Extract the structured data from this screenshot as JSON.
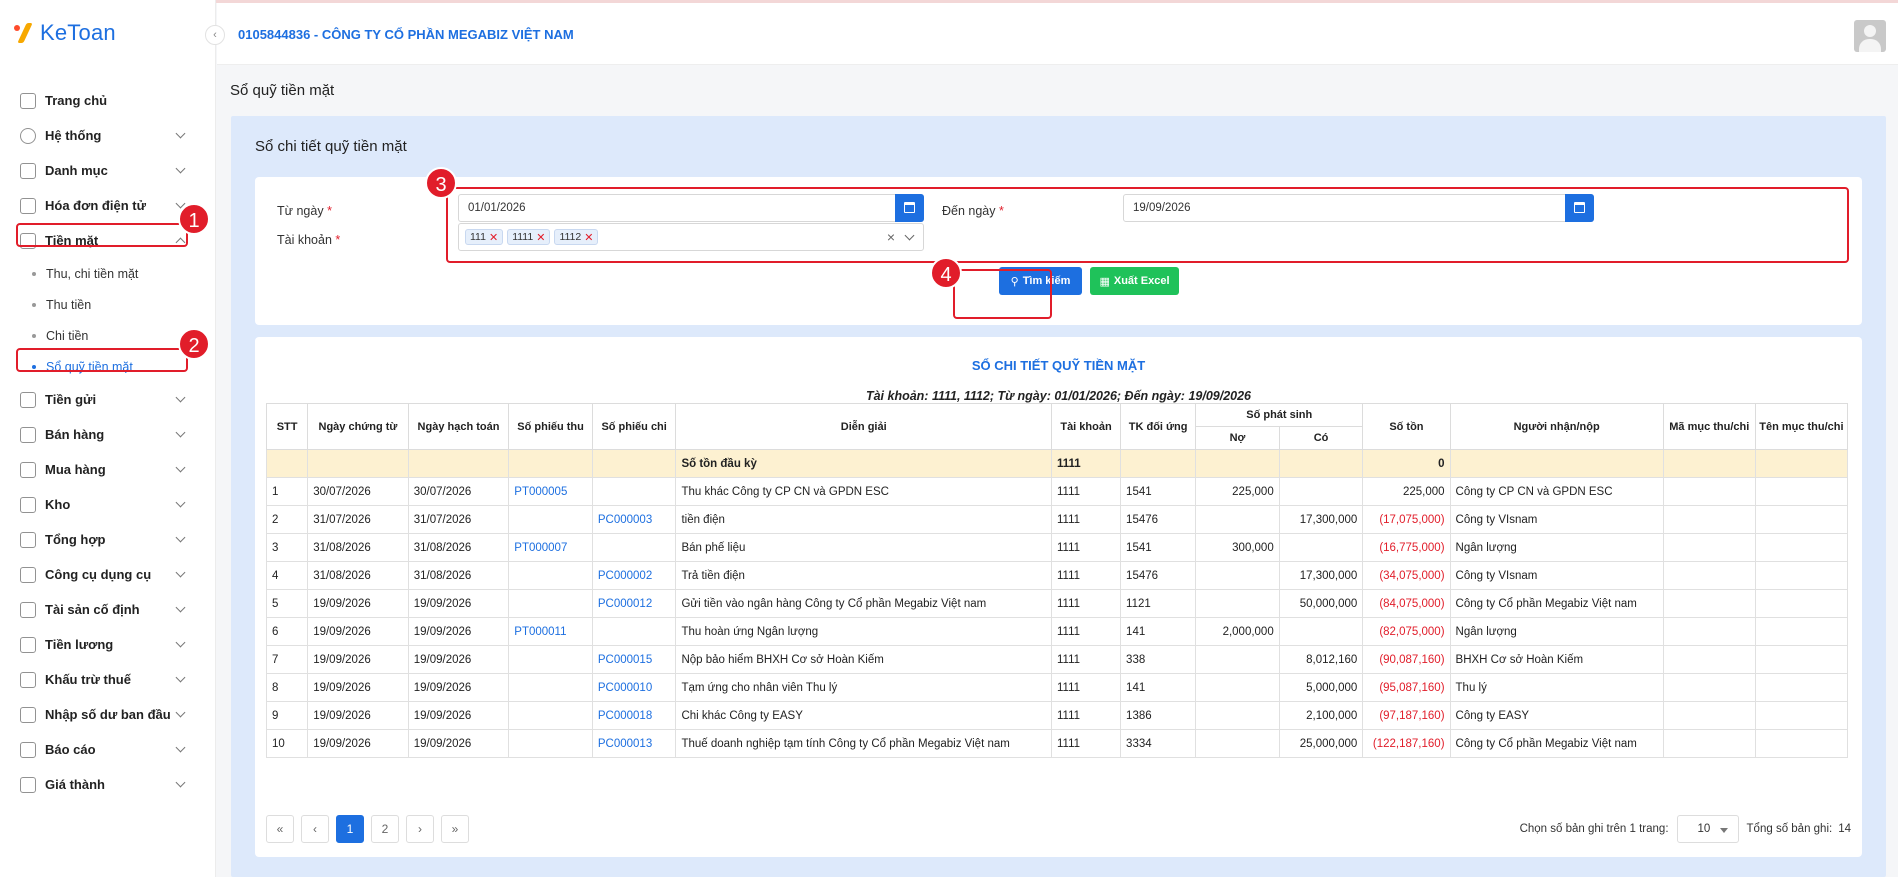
{
  "app": {
    "logo_text": "KeToan",
    "company": "0105844836 - CÔNG TY CỔ PHẦN MEGABIZ VIỆT NAM"
  },
  "sidebar": {
    "items": [
      {
        "label": "Trang chủ",
        "icon": "home-icon",
        "chevron": false
      },
      {
        "label": "Hệ thống",
        "icon": "gear-icon",
        "chevron": true
      },
      {
        "label": "Danh mục",
        "icon": "grid-icon",
        "chevron": true
      },
      {
        "label": "Hóa đơn điện tử",
        "icon": "invoice-icon",
        "chevron": true
      },
      {
        "label": "Tiền mặt",
        "icon": "cash-icon",
        "chevron": true,
        "expanded": true
      },
      {
        "label": "Tiền gửi",
        "icon": "bank-icon",
        "chevron": true
      },
      {
        "label": "Bán hàng",
        "icon": "bag-icon",
        "chevron": true
      },
      {
        "label": "Mua hàng",
        "icon": "cart-icon",
        "chevron": true
      },
      {
        "label": "Kho",
        "icon": "warehouse-icon",
        "chevron": true
      },
      {
        "label": "Tổng hợp",
        "icon": "chart-icon",
        "chevron": true
      },
      {
        "label": "Công cụ dụng cụ",
        "icon": "toolbox-icon",
        "chevron": true
      },
      {
        "label": "Tài sản cố định",
        "icon": "asset-icon",
        "chevron": true
      },
      {
        "label": "Tiền lương",
        "icon": "salary-icon",
        "chevron": true
      },
      {
        "label": "Khấu trừ thuế",
        "icon": "tax-icon",
        "chevron": true
      },
      {
        "label": "Nhập số dư ban đầu",
        "icon": "balance-icon",
        "chevron": true
      },
      {
        "label": "Báo cáo",
        "icon": "report-icon",
        "chevron": true
      },
      {
        "label": "Giá thành",
        "icon": "cost-icon",
        "chevron": true
      }
    ],
    "cash_sub": [
      "Thu, chi tiền mặt",
      "Thu tiền",
      "Chi tiền",
      "Sổ quỹ tiền mặt"
    ]
  },
  "annotations": [
    "1",
    "2",
    "3",
    "4"
  ],
  "page": {
    "title": "Sổ quỹ tiền mặt",
    "section_title": "Sổ chi tiết quỹ tiền mặt"
  },
  "filter": {
    "from_label": "Từ ngày",
    "from_value": "01/01/2026",
    "to_label": "Đến ngày",
    "to_value": "19/09/2026",
    "account_label": "Tài khoản",
    "required_mark": "*",
    "accounts": [
      "111",
      "1111",
      "1112"
    ],
    "search_label": "Tìm kiếm",
    "export_label": "Xuất Excel"
  },
  "report": {
    "title": "SỔ CHI TIẾT QUỸ TIỀN MẶT",
    "subtitle": "Tài khoản: 1111, 1112; Từ ngày: 01/01/2026; Đến ngày: 19/09/2026",
    "headers": {
      "stt": "STT",
      "ngay_ct": "Ngày chứng từ",
      "ngay_ht": "Ngày hạch toán",
      "so_thu": "Số phiếu thu",
      "so_chi": "Số phiếu chi",
      "dien_giai": "Diễn giải",
      "tk": "Tài khoản",
      "tk_du": "TK đối ứng",
      "phat_sinh": "Số phát sinh",
      "no": "Nợ",
      "co": "Có",
      "ton": "Số tồn",
      "nguoi": "Người nhận/nộp",
      "ma_muc": "Mã mục thu/chi",
      "ten_muc": "Tên mục thu/chi"
    },
    "opening": {
      "label": "Số tồn đầu kỳ",
      "account": "1111",
      "balance": "0"
    },
    "rows": [
      {
        "stt": "1",
        "ngay_ct": "30/07/2026",
        "ngay_ht": "30/07/2026",
        "so_thu": "PT000005",
        "so_chi": "",
        "dien_giai": "Thu khác Công ty CP CN và GPDN ESC",
        "tk": "1111",
        "tk_du": "1541",
        "no": "225,000",
        "co": "",
        "ton": "225,000",
        "neg": false,
        "nguoi": "Công ty CP CN và GPDN ESC"
      },
      {
        "stt": "2",
        "ngay_ct": "31/07/2026",
        "ngay_ht": "31/07/2026",
        "so_thu": "",
        "so_chi": "PC000003",
        "dien_giai": "tiền điện",
        "tk": "1111",
        "tk_du": "15476",
        "no": "",
        "co": "17,300,000",
        "ton": "(17,075,000)",
        "neg": true,
        "nguoi": "Công ty VIsnam"
      },
      {
        "stt": "3",
        "ngay_ct": "31/08/2026",
        "ngay_ht": "31/08/2026",
        "so_thu": "PT000007",
        "so_chi": "",
        "dien_giai": "Bán phế liệu",
        "tk": "1111",
        "tk_du": "1541",
        "no": "300,000",
        "co": "",
        "ton": "(16,775,000)",
        "neg": true,
        "nguoi": "Ngân lượng"
      },
      {
        "stt": "4",
        "ngay_ct": "31/08/2026",
        "ngay_ht": "31/08/2026",
        "so_thu": "",
        "so_chi": "PC000002",
        "dien_giai": "Trả tiền điện",
        "tk": "1111",
        "tk_du": "15476",
        "no": "",
        "co": "17,300,000",
        "ton": "(34,075,000)",
        "neg": true,
        "nguoi": "Công ty VIsnam"
      },
      {
        "stt": "5",
        "ngay_ct": "19/09/2026",
        "ngay_ht": "19/09/2026",
        "so_thu": "",
        "so_chi": "PC000012",
        "dien_giai": "Gửi tiền vào ngân hàng Công ty Cổ phần Megabiz Việt nam",
        "tk": "1111",
        "tk_du": "1121",
        "no": "",
        "co": "50,000,000",
        "ton": "(84,075,000)",
        "neg": true,
        "nguoi": "Công ty Cổ phần Megabiz Việt nam"
      },
      {
        "stt": "6",
        "ngay_ct": "19/09/2026",
        "ngay_ht": "19/09/2026",
        "so_thu": "PT000011",
        "so_chi": "",
        "dien_giai": "Thu hoàn ứng Ngân lượng",
        "tk": "1111",
        "tk_du": "141",
        "no": "2,000,000",
        "co": "",
        "ton": "(82,075,000)",
        "neg": true,
        "nguoi": "Ngân lượng"
      },
      {
        "stt": "7",
        "ngay_ct": "19/09/2026",
        "ngay_ht": "19/09/2026",
        "so_thu": "",
        "so_chi": "PC000015",
        "dien_giai": "Nộp bảo hiểm BHXH Cơ sở Hoàn Kiếm",
        "tk": "1111",
        "tk_du": "338",
        "no": "",
        "co": "8,012,160",
        "ton": "(90,087,160)",
        "neg": true,
        "nguoi": "BHXH Cơ sở Hoàn Kiếm"
      },
      {
        "stt": "8",
        "ngay_ct": "19/09/2026",
        "ngay_ht": "19/09/2026",
        "so_thu": "",
        "so_chi": "PC000010",
        "dien_giai": "Tạm ứng cho nhân viên Thu lý",
        "tk": "1111",
        "tk_du": "141",
        "no": "",
        "co": "5,000,000",
        "ton": "(95,087,160)",
        "neg": true,
        "nguoi": "Thu lý"
      },
      {
        "stt": "9",
        "ngay_ct": "19/09/2026",
        "ngay_ht": "19/09/2026",
        "so_thu": "",
        "so_chi": "PC000018",
        "dien_giai": "Chi khác Công ty EASY",
        "tk": "1111",
        "tk_du": "1386",
        "no": "",
        "co": "2,100,000",
        "ton": "(97,187,160)",
        "neg": true,
        "nguoi": "Công ty EASY"
      },
      {
        "stt": "10",
        "ngay_ct": "19/09/2026",
        "ngay_ht": "19/09/2026",
        "so_thu": "",
        "so_chi": "PC000013",
        "dien_giai": "Thuế doanh nghiệp tạm tính Công ty Cổ phần Megabiz Việt nam",
        "tk": "1111",
        "tk_du": "3334",
        "no": "",
        "co": "25,000,000",
        "ton": "(122,187,160)",
        "neg": true,
        "nguoi": "Công ty Cổ phần Megabiz Việt nam"
      }
    ]
  },
  "pagination": {
    "first": "«",
    "prev": "‹",
    "pages": [
      "1",
      "2"
    ],
    "current": "1",
    "next": "›",
    "last": "»",
    "page_size_label": "Chọn số bản ghi trên 1 trang:",
    "page_size": "10",
    "total_label": "Tổng số bản ghi:",
    "total": "14"
  },
  "colors": {
    "accent": "#1d6fe0",
    "negative": "#e11d2a",
    "export": "#1fc25a",
    "opening_row": "#fdf1d1",
    "annotation": "#e11d2a"
  }
}
